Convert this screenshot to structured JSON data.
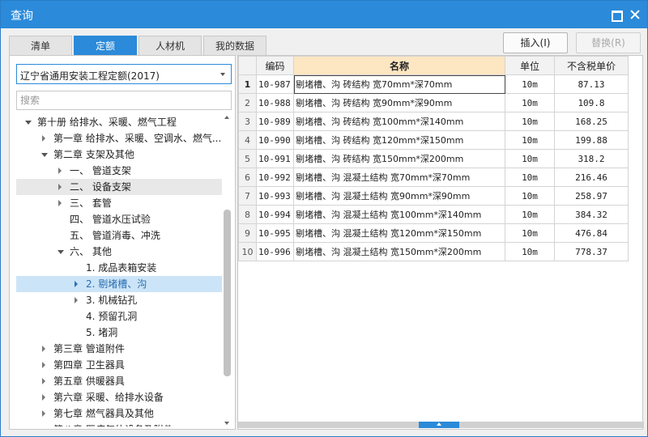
{
  "window": {
    "title": "查询"
  },
  "tabs": [
    {
      "label": "清单",
      "active": false
    },
    {
      "label": "定额",
      "active": true
    },
    {
      "label": "人材机",
      "active": false
    },
    {
      "label": "我的数据",
      "active": false
    }
  ],
  "actions": {
    "insert_label": "插入(I)",
    "replace_label": "替换(R)",
    "replace_disabled": true
  },
  "library": {
    "selected": "辽宁省通用安装工程定额(2017)"
  },
  "search": {
    "placeholder": "搜索",
    "value": ""
  },
  "tree": [
    {
      "label": "第十册 给排水、采暖、燃气工程",
      "level": 0,
      "state": "expanded"
    },
    {
      "label": "第一章 给排水、采暖、空调水、燃气...",
      "level": 1,
      "state": "collapsed"
    },
    {
      "label": "第二章 支架及其他",
      "level": 1,
      "state": "expanded"
    },
    {
      "label": "一、 管道支架",
      "level": 2,
      "state": "collapsed"
    },
    {
      "label": "二、 设备支架",
      "level": 2,
      "state": "collapsed",
      "hover": true
    },
    {
      "label": "三、 套管",
      "level": 2,
      "state": "collapsed"
    },
    {
      "label": "四、 管道水压试验",
      "level": 2,
      "state": "leaf"
    },
    {
      "label": "五、 管道消毒、冲洗",
      "level": 2,
      "state": "leaf"
    },
    {
      "label": "六、 其他",
      "level": 2,
      "state": "expanded"
    },
    {
      "label": "1. 成品表箱安装",
      "level": 3,
      "state": "leaf"
    },
    {
      "label": "2. 剔堵槽、沟",
      "level": 3,
      "state": "collapsed",
      "selected": true
    },
    {
      "label": "3. 机械钻孔",
      "level": 3,
      "state": "collapsed"
    },
    {
      "label": "4. 预留孔洞",
      "level": 3,
      "state": "leaf"
    },
    {
      "label": "5. 堵洞",
      "level": 3,
      "state": "leaf"
    },
    {
      "label": "第三章 管道附件",
      "level": 1,
      "state": "collapsed"
    },
    {
      "label": "第四章 卫生器具",
      "level": 1,
      "state": "collapsed"
    },
    {
      "label": "第五章 供暖器具",
      "level": 1,
      "state": "collapsed"
    },
    {
      "label": "第六章 采暖、给排水设备",
      "level": 1,
      "state": "collapsed"
    },
    {
      "label": "第七章 燃气器具及其他",
      "level": 1,
      "state": "collapsed"
    },
    {
      "label": "第八章 医疗气体设备及附件",
      "level": 1,
      "state": "collapsed"
    }
  ],
  "table": {
    "columns": [
      "",
      "编码",
      "名称",
      "单位",
      "不含税单价"
    ],
    "current_row": 1,
    "rows": [
      {
        "no": "1",
        "code": "10-987",
        "name": "剔堵槽、沟 砖结构 宽70mm*深70mm",
        "unit": "10m",
        "price": "87.13"
      },
      {
        "no": "2",
        "code": "10-988",
        "name": "剔堵槽、沟 砖结构 宽90mm*深90mm",
        "unit": "10m",
        "price": "109.8"
      },
      {
        "no": "3",
        "code": "10-989",
        "name": "剔堵槽、沟 砖结构 宽100mm*深140mm",
        "unit": "10m",
        "price": "168.25"
      },
      {
        "no": "4",
        "code": "10-990",
        "name": "剔堵槽、沟 砖结构 宽120mm*深150mm",
        "unit": "10m",
        "price": "199.88"
      },
      {
        "no": "5",
        "code": "10-991",
        "name": "剔堵槽、沟 砖结构 宽150mm*深200mm",
        "unit": "10m",
        "price": "318.2"
      },
      {
        "no": "6",
        "code": "10-992",
        "name": "剔堵槽、沟 混凝土结构 宽70mm*深70mm",
        "unit": "10m",
        "price": "216.46"
      },
      {
        "no": "7",
        "code": "10-993",
        "name": "剔堵槽、沟 混凝土结构 宽90mm*深90mm",
        "unit": "10m",
        "price": "258.97"
      },
      {
        "no": "8",
        "code": "10-994",
        "name": "剔堵槽、沟 混凝土结构 宽100mm*深140mm",
        "unit": "10m",
        "price": "384.32"
      },
      {
        "no": "9",
        "code": "10-995",
        "name": "剔堵槽、沟 混凝土结构 宽120mm*深150mm",
        "unit": "10m",
        "price": "476.84"
      },
      {
        "no": "10",
        "code": "10-996",
        "name": "剔堵槽、沟 混凝土结构 宽150mm*深200mm",
        "unit": "10m",
        "price": "778.37"
      }
    ]
  },
  "colors": {
    "accent": "#2b8ad9",
    "name_header": "#fde6c2",
    "selection": "#cce4f7"
  },
  "icons": [
    "maximize-icon",
    "close-icon",
    "dropdown-arrow-icon",
    "tree-caret-icon",
    "scroll-up-icon",
    "scroll-down-icon",
    "collapse-panel-icon"
  ]
}
